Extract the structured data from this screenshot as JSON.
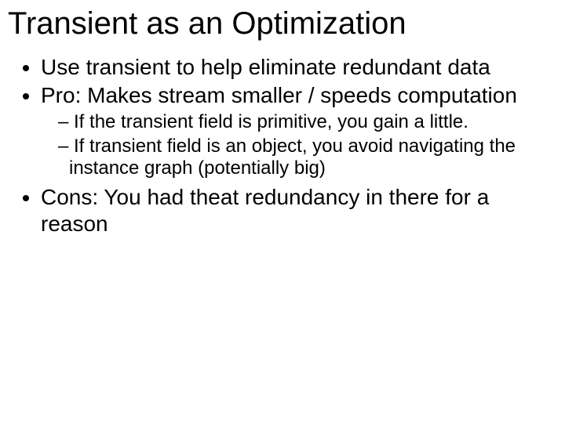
{
  "title": "Transient as an Optimization",
  "bullets": {
    "b1": "Use transient to help eliminate redundant data",
    "b2": "Pro: Makes stream smaller / speeds computation",
    "b2_sub": {
      "s1": "If the transient field is primitive, you gain a little.",
      "s2": "If transient field is an object, you avoid navigating the instance graph (potentially big)"
    },
    "b3": "Cons: You had theat redundancy in there for a reason"
  }
}
